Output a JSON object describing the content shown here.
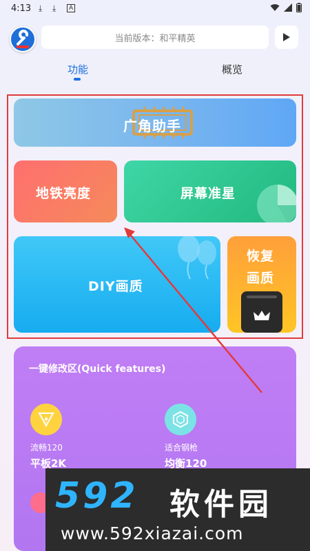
{
  "status_bar": {
    "time": "4:13",
    "icons": [
      "download-icon",
      "download-icon",
      "font-icon",
      "wifi-icon",
      "signal-icon",
      "battery-icon"
    ]
  },
  "header": {
    "version_text": "当前版本：和平精英"
  },
  "tabs": [
    {
      "label": "功能",
      "active": true
    },
    {
      "label": "概览",
      "active": false
    }
  ],
  "cards": {
    "wide_angle": "广角助手",
    "subway_brightness": "地铁亮度",
    "crosshair": "屏幕准星",
    "diy_quality": "DIY画质",
    "restore_line1": "恢复",
    "restore_line2": "画质"
  },
  "quick": {
    "title": "一键修改区(Quick features)",
    "features": [
      {
        "line1": "流畅120",
        "line2": "平板2K",
        "icon": "lightning-icon"
      },
      {
        "line1": "适合钢枪",
        "line2": "均衡120",
        "icon": "hexagon-icon"
      }
    ]
  },
  "watermark": {
    "logo": "592",
    "name": "软件园",
    "url": "www.592xiazai.com"
  },
  "colors": {
    "accent": "#1e6fe0",
    "highlight": "#e23b3b"
  }
}
